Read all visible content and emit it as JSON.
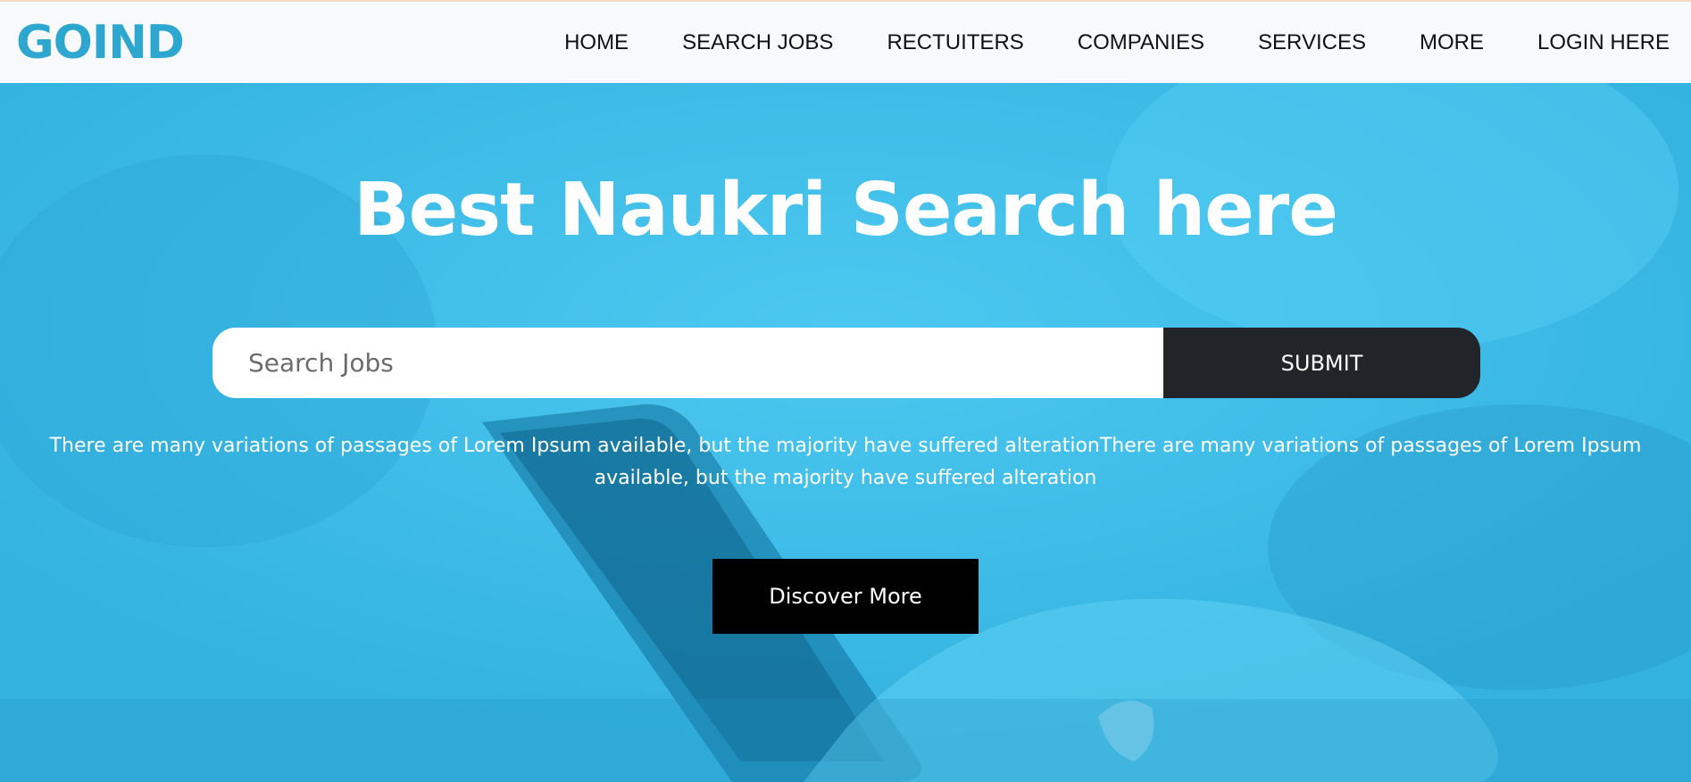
{
  "brand": {
    "logo_text": "GOIND"
  },
  "nav": {
    "items": [
      {
        "label": "HOME"
      },
      {
        "label": "SEARCH JOBS"
      },
      {
        "label": "RECTUITERS"
      },
      {
        "label": "COMPANIES"
      },
      {
        "label": "SERVICES"
      },
      {
        "label": "MORE"
      },
      {
        "label": "LOGIN HERE"
      }
    ]
  },
  "hero": {
    "title": "Best Naukri Search here",
    "search_placeholder": "Search Jobs",
    "submit_label": "SUBMIT",
    "description": "There are many variations of passages of Lorem Ipsum available, but the majority have suffered alterationThere are many variations of passages of Lorem Ipsum available, but the majority have suffered alteration",
    "discover_label": "Discover More"
  },
  "colors": {
    "brand": "#2ea7d0",
    "hero_bg": "#3dbde9",
    "submit_bg": "#212428",
    "discover_bg": "#000000"
  }
}
